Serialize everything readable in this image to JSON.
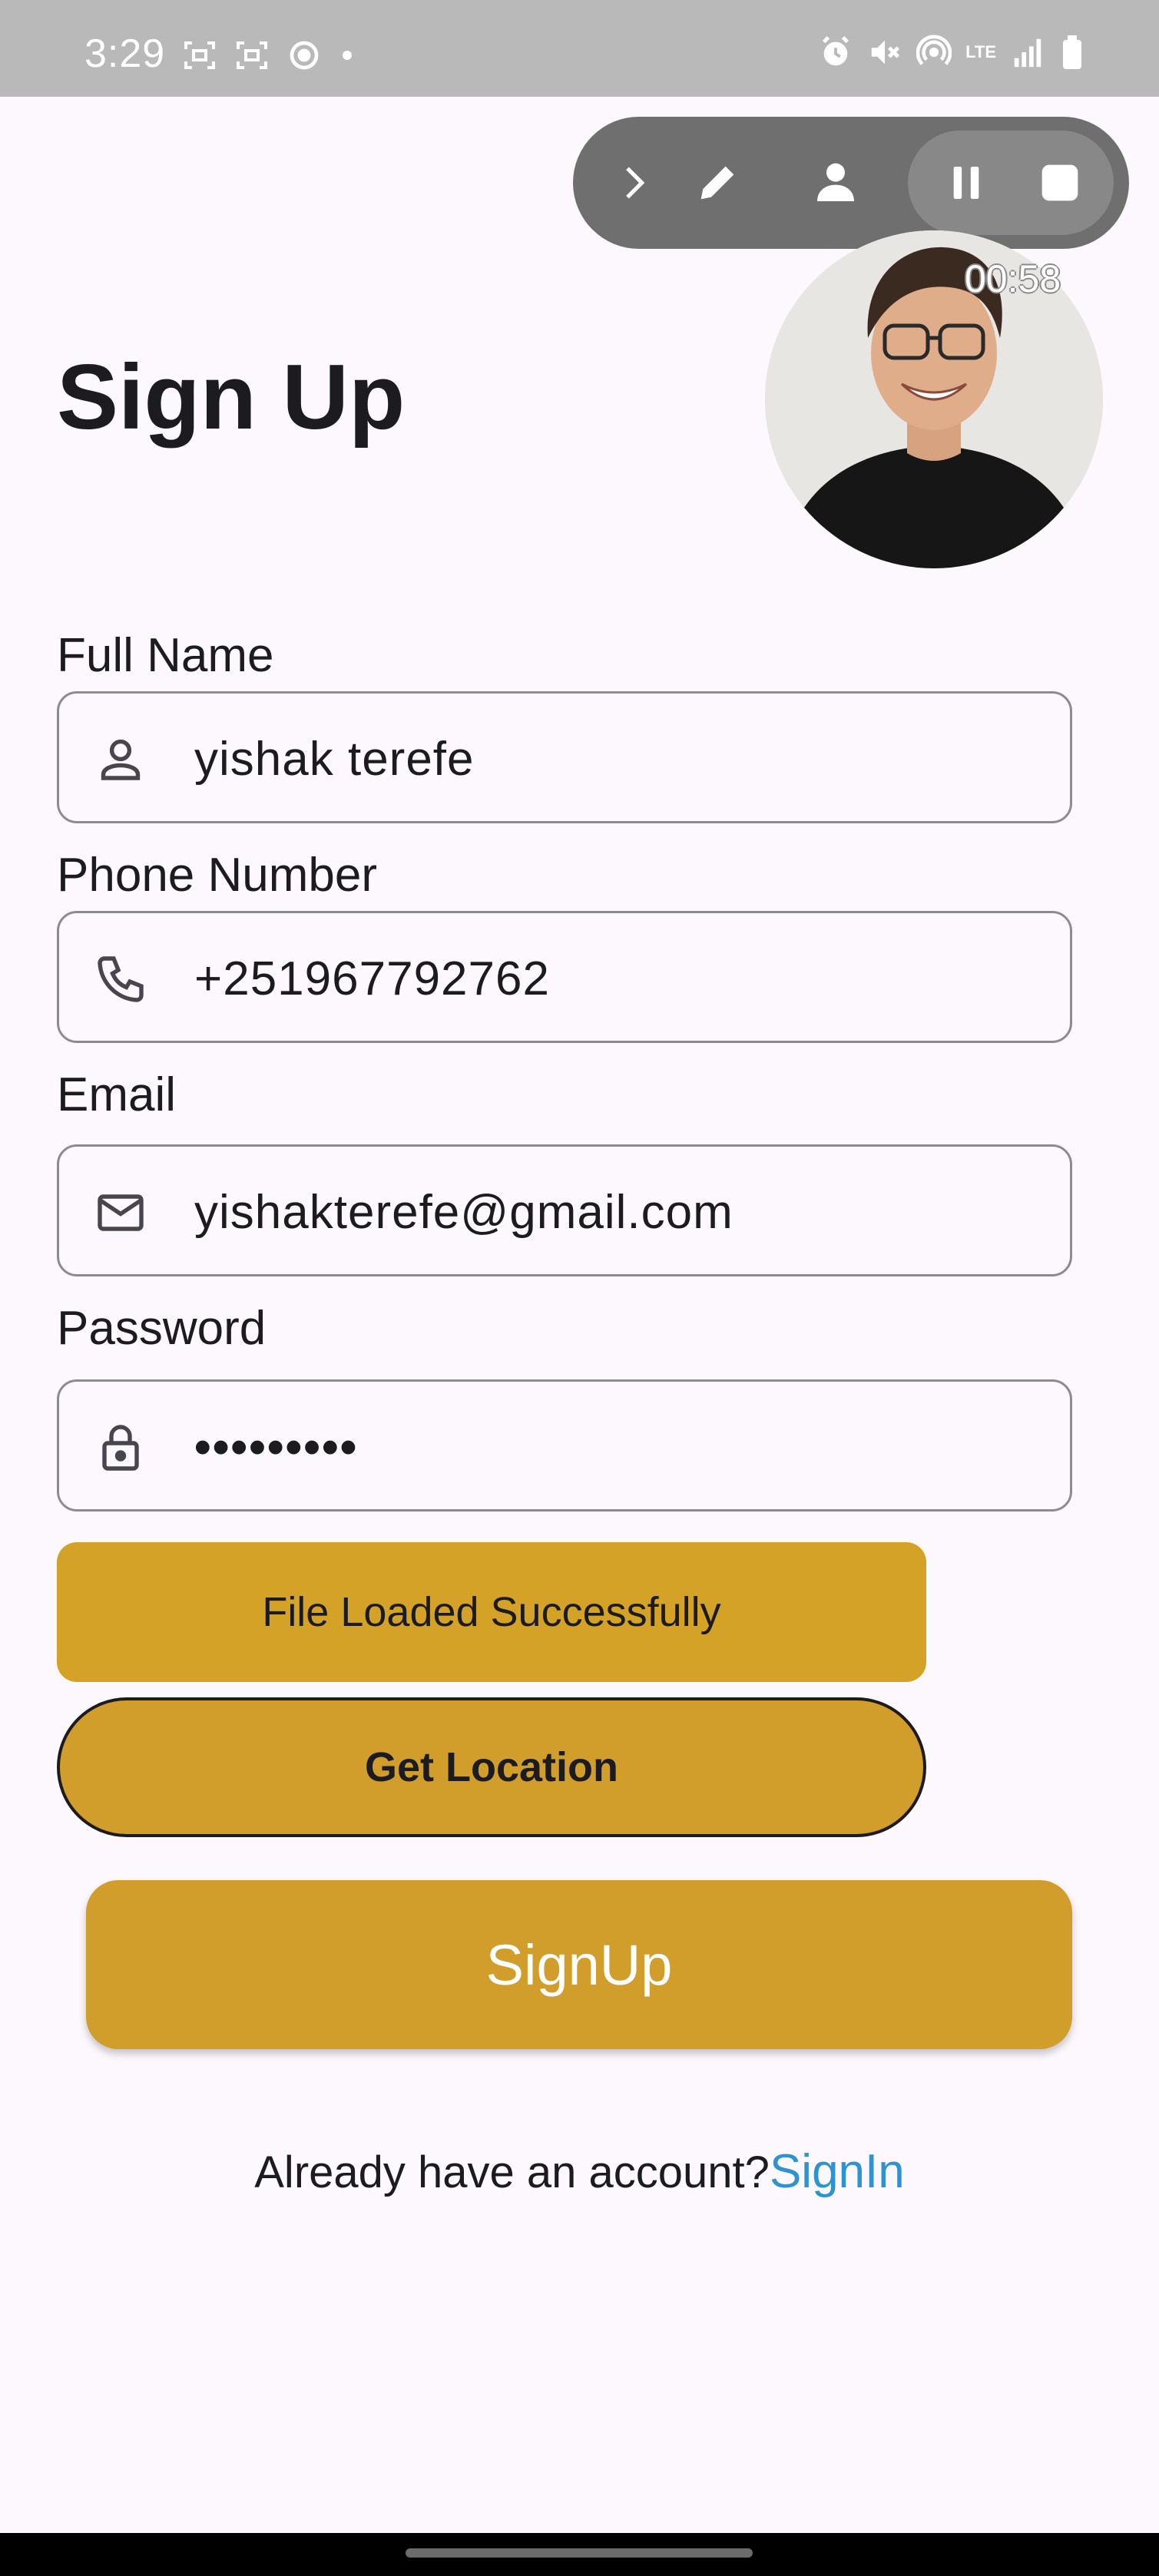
{
  "status_bar": {
    "time": "3:29",
    "left_icons": [
      "screenshot-icon",
      "screenshot-icon",
      "sync-icon",
      "dot-icon"
    ],
    "right_icons": [
      "alarm-icon",
      "mute-icon",
      "hotspot-icon",
      "lte-icon",
      "signal-icon",
      "battery-icon"
    ],
    "lte_label": "LTE"
  },
  "recorder": {
    "timer": "00:58",
    "icons": [
      "chevron-right-icon",
      "pencil-icon",
      "person-icon",
      "pause-icon",
      "stop-icon"
    ]
  },
  "page": {
    "title": "Sign Up"
  },
  "form": {
    "full_name": {
      "label": "Full Name",
      "value": "yishak terefe",
      "icon": "person-icon"
    },
    "phone": {
      "label": "Phone Number",
      "value": "+251967792762",
      "icon": "phone-icon"
    },
    "email": {
      "label": "Email",
      "value": "yishakterefe@gmail.com",
      "icon": "mail-icon"
    },
    "password": {
      "label": "Password",
      "value": "•••••••••",
      "icon": "lock-icon"
    }
  },
  "buttons": {
    "file_loaded": "File Loaded Successfully",
    "get_location": "Get Location",
    "signup": "SignUp"
  },
  "footer": {
    "prompt": "Already have an account?",
    "link": "SignIn"
  },
  "colors": {
    "accent": "#d19e2b",
    "link": "#2e93d1",
    "background": "#fdf8fd"
  }
}
